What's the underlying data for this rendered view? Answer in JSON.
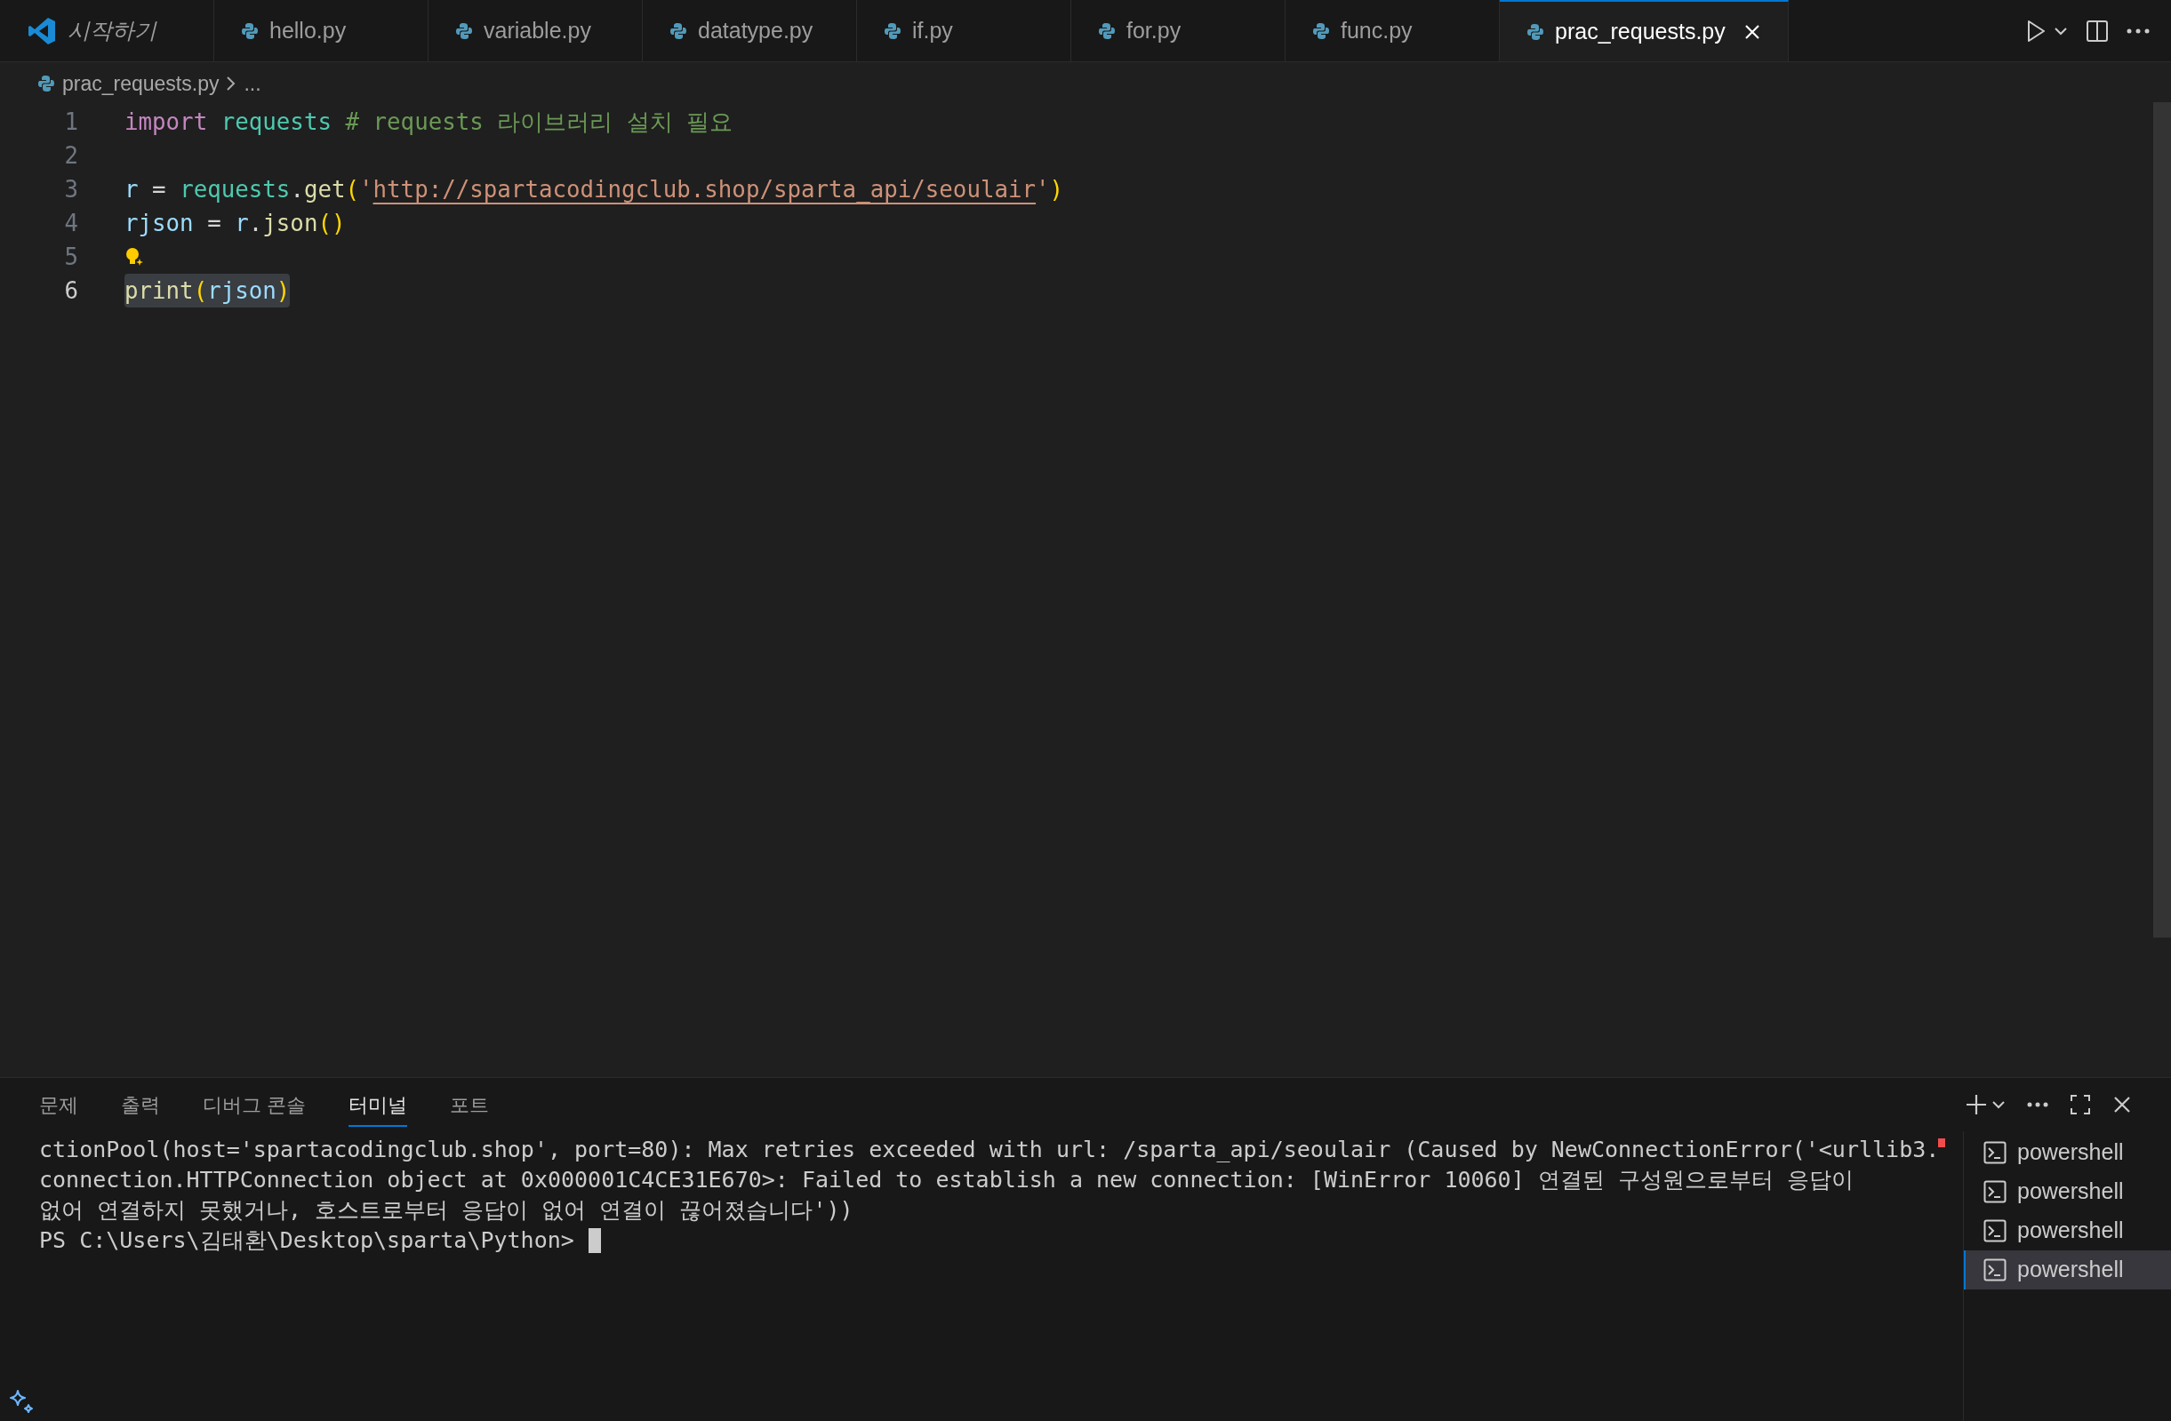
{
  "tabs": [
    {
      "label": "시작하기",
      "kind": "welcome",
      "selected": false
    },
    {
      "label": "hello.py",
      "kind": "python",
      "selected": false
    },
    {
      "label": "variable.py",
      "kind": "python",
      "selected": false
    },
    {
      "label": "datatype.py",
      "kind": "python",
      "selected": false
    },
    {
      "label": "if.py",
      "kind": "python",
      "selected": false
    },
    {
      "label": "for.py",
      "kind": "python",
      "selected": false
    },
    {
      "label": "func.py",
      "kind": "python",
      "selected": false
    },
    {
      "label": "prac_requests.py",
      "kind": "python",
      "selected": true
    }
  ],
  "breadcrumb": {
    "file": "prac_requests.py",
    "more": "..."
  },
  "editor": {
    "lines": [
      {
        "number": "1",
        "current": false,
        "lightbulb": false,
        "tokens": [
          {
            "text": "import ",
            "kind": "keyword"
          },
          {
            "text": "requests ",
            "kind": "module"
          },
          {
            "text": "# requests 라이브러리 설치 필요",
            "kind": "comment"
          }
        ]
      },
      {
        "number": "2",
        "current": false,
        "lightbulb": false
      },
      {
        "number": "3",
        "current": false,
        "lightbulb": false,
        "tokens": [
          {
            "text": "r",
            "kind": "variable"
          },
          {
            "text": " = ",
            "kind": "plain"
          },
          {
            "text": "requests",
            "kind": "module"
          },
          {
            "text": ".",
            "kind": "plain"
          },
          {
            "text": "get",
            "kind": "function"
          },
          {
            "text": "(",
            "kind": "bracket"
          },
          {
            "text": "'",
            "kind": "string"
          },
          {
            "text": "http://spartacodingclub.shop/sparta_api/seoulair",
            "kind": "link"
          },
          {
            "text": "'",
            "kind": "string"
          },
          {
            "text": ")",
            "kind": "bracket"
          }
        ]
      },
      {
        "number": "4",
        "current": false,
        "lightbulb": false,
        "tokens": [
          {
            "text": "rjson",
            "kind": "variable"
          },
          {
            "text": " = ",
            "kind": "plain"
          },
          {
            "text": "r",
            "kind": "variable"
          },
          {
            "text": ".",
            "kind": "plain"
          },
          {
            "text": "json",
            "kind": "function"
          },
          {
            "text": "()",
            "kind": "bracket"
          }
        ]
      },
      {
        "number": "5",
        "current": false,
        "lightbulb": true
      },
      {
        "number": "6",
        "current": true,
        "lightbulb": false,
        "tokens": [
          {
            "text": "print",
            "kind": "function"
          },
          {
            "text": "(",
            "kind": "bracket"
          },
          {
            "text": "rjson",
            "kind": "variable"
          },
          {
            "text": ")",
            "kind": "bracket"
          }
        ]
      }
    ]
  },
  "panel": {
    "tabs": [
      {
        "label": "문제",
        "selected": false
      },
      {
        "label": "출력",
        "selected": false
      },
      {
        "label": "디버그 콘솔",
        "selected": false
      },
      {
        "label": "터미널",
        "selected": true
      },
      {
        "label": "포트",
        "selected": false
      }
    ],
    "terminal_lines": [
      "ctionPool(host='spartacodingclub.shop', port=80): Max retries exceeded with url: /sparta_api/seoulair (Caused by NewConnectionError('<urllib3.",
      "connection.HTTPConnection object at 0x000001C4CE31E670>: Failed to establish a new connection: [WinError 10060] 연결된 구성원으로부터 응답이",
      "없어 연결하지 못했거나, 호스트로부터 응답이 없어 연결이 끊어졌습니다'))"
    ],
    "prompt": "PS C:\\Users\\김태환\\Desktop\\sparta\\Python>",
    "terminals": [
      {
        "label": "powershell",
        "selected": false
      },
      {
        "label": "powershell",
        "selected": false
      },
      {
        "label": "powershell",
        "selected": false
      },
      {
        "label": "powershell",
        "selected": true
      }
    ]
  }
}
